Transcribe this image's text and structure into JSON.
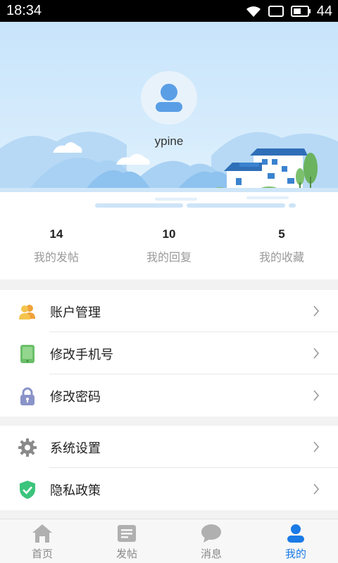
{
  "status_bar": {
    "time": "18:34",
    "battery": "44"
  },
  "profile": {
    "username": "ypine"
  },
  "stats": [
    {
      "count": "14",
      "label": "我的发帖"
    },
    {
      "count": "10",
      "label": "我的回复"
    },
    {
      "count": "5",
      "label": "我的收藏"
    }
  ],
  "menu_group_1": [
    {
      "label": "账户管理",
      "icon": "users-icon"
    },
    {
      "label": "修改手机号",
      "icon": "phone-icon"
    },
    {
      "label": "修改密码",
      "icon": "lock-icon"
    }
  ],
  "menu_group_2": [
    {
      "label": "系统设置",
      "icon": "gear-icon"
    },
    {
      "label": "隐私政策",
      "icon": "shield-check-icon"
    }
  ],
  "tabbar": [
    {
      "label": "首页",
      "icon": "home-icon",
      "active": false
    },
    {
      "label": "发帖",
      "icon": "post-icon",
      "active": false
    },
    {
      "label": "消息",
      "icon": "message-icon",
      "active": false
    },
    {
      "label": "我的",
      "icon": "profile-icon",
      "active": true
    }
  ],
  "colors": {
    "accent": "#1a7ae6",
    "header_bg": "#d6ecfc",
    "text_muted": "#999999"
  }
}
